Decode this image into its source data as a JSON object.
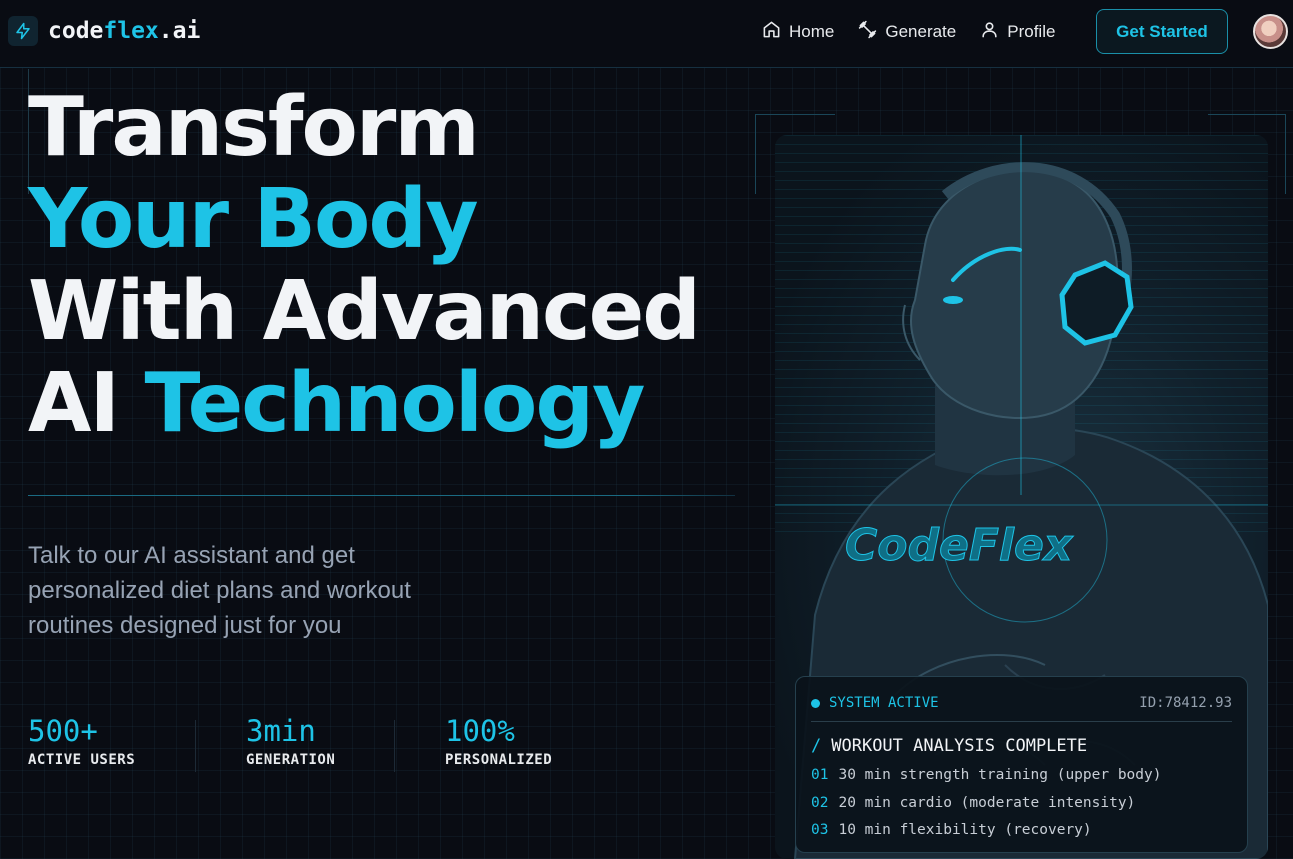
{
  "brand": {
    "part1": "code",
    "part2": "flex",
    "part3": ".ai"
  },
  "nav": {
    "items": [
      {
        "label": "Home",
        "icon": "home-icon"
      },
      {
        "label": "Generate",
        "icon": "dumbbell-icon"
      },
      {
        "label": "Profile",
        "icon": "user-icon"
      }
    ],
    "cta": "Get Started"
  },
  "hero": {
    "line1": "Transform",
    "line2": "Your Body",
    "line3": "With Advanced",
    "line4a": "AI ",
    "line4b": "Technology",
    "subtitle": "Talk to our AI assistant and get personalized diet plans and workout routines designed just for you"
  },
  "stats": [
    {
      "value": "500+",
      "label": "ACTIVE USERS"
    },
    {
      "value": "3min",
      "label": "GENERATION"
    },
    {
      "value": "100%",
      "label": "PERSONALIZED"
    }
  ],
  "art": {
    "chest_text": "CodeFlex"
  },
  "status_card": {
    "status": "SYSTEM ACTIVE",
    "id": "ID:78412.93",
    "heading_prefix": "/",
    "heading": "WORKOUT ANALYSIS COMPLETE",
    "items": [
      {
        "num": "01",
        "text": "30 min strength training (upper body)"
      },
      {
        "num": "02",
        "text": "20 min cardio (moderate intensity)"
      },
      {
        "num": "03",
        "text": "10 min flexibility (recovery)"
      }
    ]
  },
  "colors": {
    "accent": "#1ec3e6",
    "background": "#090c13",
    "muted_text": "#97a3b4"
  }
}
